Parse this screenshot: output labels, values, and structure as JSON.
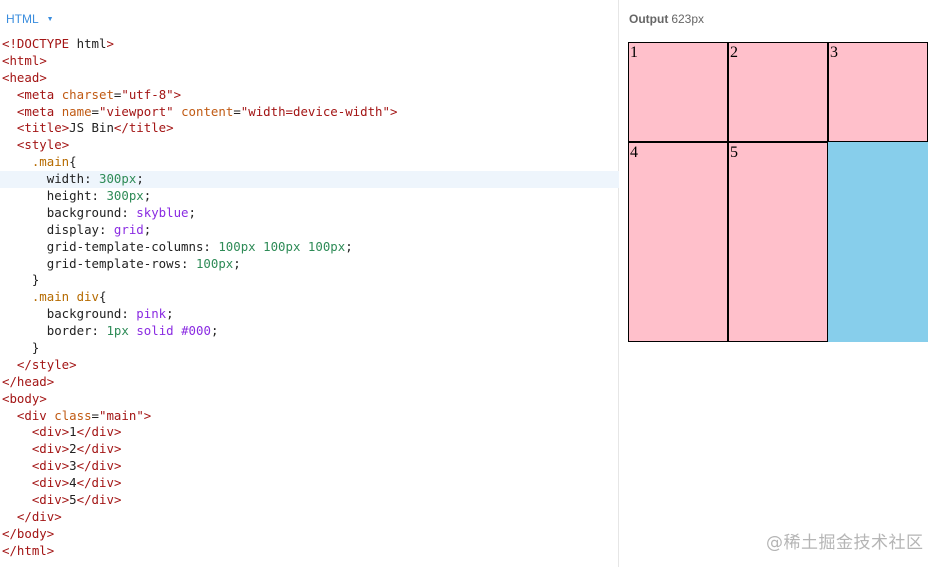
{
  "editor": {
    "language_label": "HTML",
    "code_lines": [
      "<!DOCTYPE html>",
      "<html>",
      "<head>",
      "  <meta charset=\"utf-8\">",
      "  <meta name=\"viewport\" content=\"width=device-width\">",
      "  <title>JS Bin</title>",
      "  <style>",
      "    .main{",
      "      width: 300px;",
      "      height: 300px;",
      "      background: skyblue;",
      "      display: grid;",
      "      grid-template-columns: 100px 100px 100px;",
      "      grid-template-rows: 100px;",
      "    }",
      "    .main div{",
      "      background: pink;",
      "      border: 1px solid #000;",
      "    }",
      "  </style>",
      "</head>",
      "<body>",
      "  <div class=\"main\">",
      "    <div>1</div>",
      "    <div>2</div>",
      "    <div>3</div>",
      "    <div>4</div>",
      "    <div>5</div>",
      "  </div>",
      "</body>",
      "</html>"
    ],
    "active_line_index": 8
  },
  "output": {
    "label": "Output",
    "width_text": "623px",
    "grid_items": [
      "1",
      "2",
      "3",
      "4",
      "5"
    ],
    "colors": {
      "container": "#87ceeb",
      "item": "#ffc0cb",
      "border": "#000000"
    }
  },
  "watermark": "@稀土掘金技术社区"
}
